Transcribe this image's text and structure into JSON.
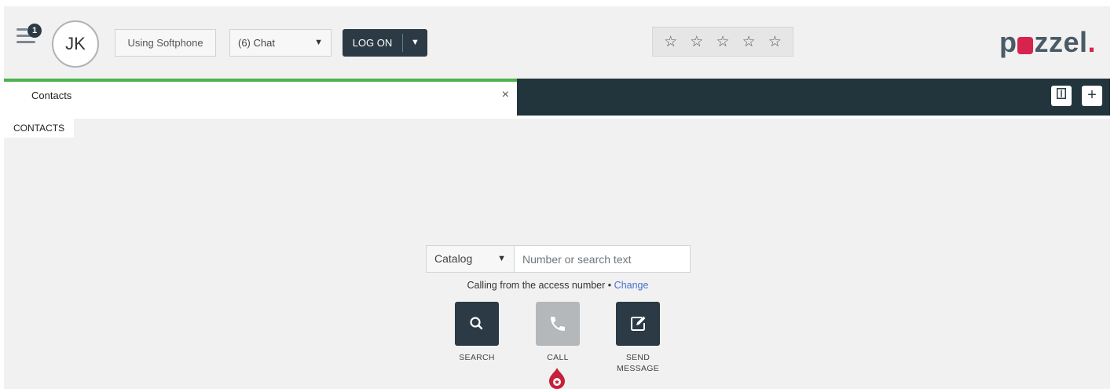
{
  "topbar": {
    "notification_count": "1",
    "avatar_initials": "JK",
    "softphone_label": "Using Softphone",
    "chat_select_value": "(6) Chat",
    "logon_label": "LOG ON",
    "rating_stars": 5,
    "rating_value": 0,
    "logo_text": {
      "p": "p",
      "rest": "zzel",
      "dot": "."
    }
  },
  "tabs": [
    {
      "label": "Contacts",
      "active": true
    }
  ],
  "section_label": "CONTACTS",
  "search": {
    "catalog_value": "Catalog",
    "placeholder": "Number or search text",
    "value": ""
  },
  "calling_text": "Calling from the access number",
  "calling_separator": "•",
  "change_link": "Change",
  "actions": {
    "search_label": "SEARCH",
    "call_label": "CALL",
    "send_message_line1": "SEND",
    "send_message_line2": "MESSAGE"
  },
  "colors": {
    "accent_dark": "#2b3a44",
    "tab_active_border": "#4cb24b",
    "brand_red": "#d6244e",
    "link": "#4a6ed1"
  }
}
